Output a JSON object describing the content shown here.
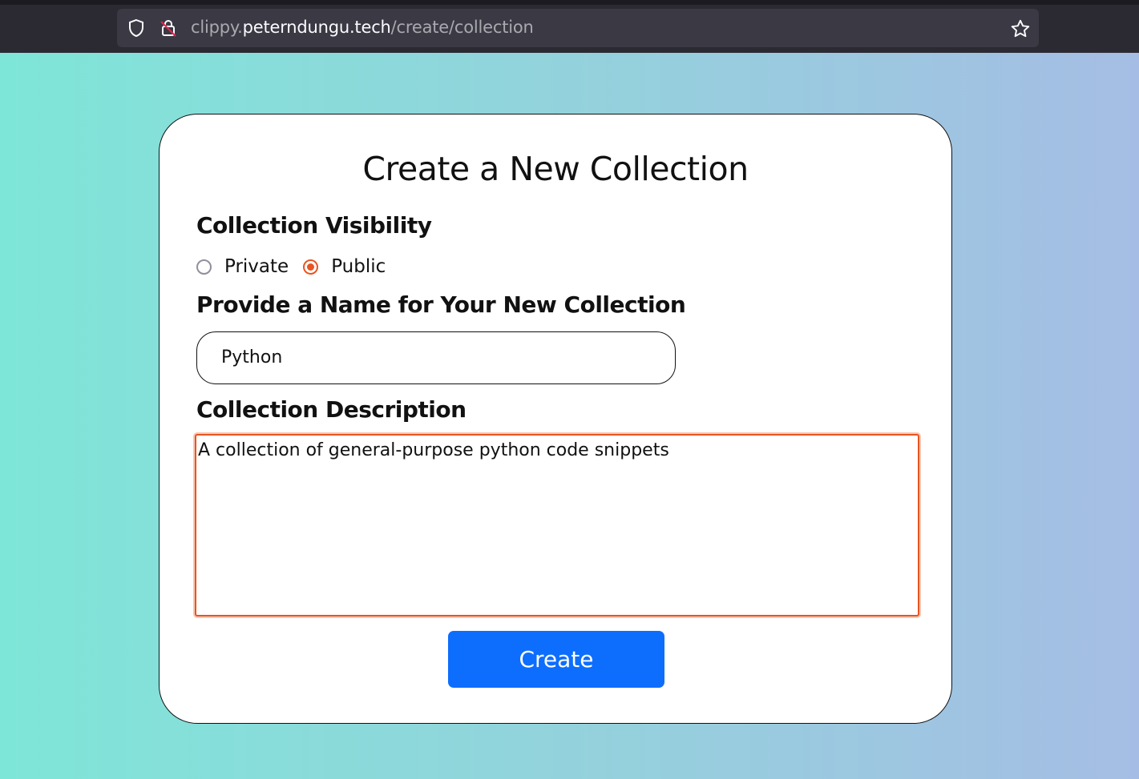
{
  "browser": {
    "url_prefix": "clippy.",
    "url_host": "peterndungu.tech",
    "url_path": "/create/collection"
  },
  "form": {
    "title": "Create a New Collection",
    "visibility_label": "Collection Visibility",
    "visibility_options": [
      {
        "label": "Private",
        "checked": false
      },
      {
        "label": "Public",
        "checked": true
      }
    ],
    "name_label": "Provide a Name for Your New Collection",
    "name_value": "Python",
    "description_label": "Collection Description",
    "description_value": "A collection of general-purpose python code snippets",
    "submit_label": "Create"
  },
  "colors": {
    "accent": "#e95420",
    "button": "#0d6efd",
    "gradient_start": "#7ee6d8",
    "gradient_end": "#a5bde4"
  }
}
